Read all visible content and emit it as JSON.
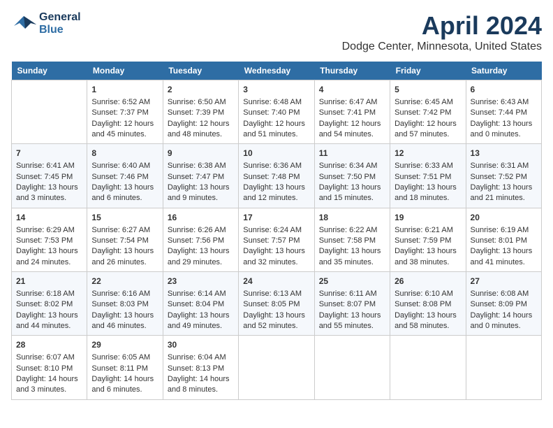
{
  "header": {
    "logo_line1": "General",
    "logo_line2": "Blue",
    "month": "April 2024",
    "location": "Dodge Center, Minnesota, United States"
  },
  "days_of_week": [
    "Sunday",
    "Monday",
    "Tuesday",
    "Wednesday",
    "Thursday",
    "Friday",
    "Saturday"
  ],
  "weeks": [
    [
      {
        "num": "",
        "data": ""
      },
      {
        "num": "1",
        "data": "Sunrise: 6:52 AM\nSunset: 7:37 PM\nDaylight: 12 hours\nand 45 minutes."
      },
      {
        "num": "2",
        "data": "Sunrise: 6:50 AM\nSunset: 7:39 PM\nDaylight: 12 hours\nand 48 minutes."
      },
      {
        "num": "3",
        "data": "Sunrise: 6:48 AM\nSunset: 7:40 PM\nDaylight: 12 hours\nand 51 minutes."
      },
      {
        "num": "4",
        "data": "Sunrise: 6:47 AM\nSunset: 7:41 PM\nDaylight: 12 hours\nand 54 minutes."
      },
      {
        "num": "5",
        "data": "Sunrise: 6:45 AM\nSunset: 7:42 PM\nDaylight: 12 hours\nand 57 minutes."
      },
      {
        "num": "6",
        "data": "Sunrise: 6:43 AM\nSunset: 7:44 PM\nDaylight: 13 hours\nand 0 minutes."
      }
    ],
    [
      {
        "num": "7",
        "data": "Sunrise: 6:41 AM\nSunset: 7:45 PM\nDaylight: 13 hours\nand 3 minutes."
      },
      {
        "num": "8",
        "data": "Sunrise: 6:40 AM\nSunset: 7:46 PM\nDaylight: 13 hours\nand 6 minutes."
      },
      {
        "num": "9",
        "data": "Sunrise: 6:38 AM\nSunset: 7:47 PM\nDaylight: 13 hours\nand 9 minutes."
      },
      {
        "num": "10",
        "data": "Sunrise: 6:36 AM\nSunset: 7:48 PM\nDaylight: 13 hours\nand 12 minutes."
      },
      {
        "num": "11",
        "data": "Sunrise: 6:34 AM\nSunset: 7:50 PM\nDaylight: 13 hours\nand 15 minutes."
      },
      {
        "num": "12",
        "data": "Sunrise: 6:33 AM\nSunset: 7:51 PM\nDaylight: 13 hours\nand 18 minutes."
      },
      {
        "num": "13",
        "data": "Sunrise: 6:31 AM\nSunset: 7:52 PM\nDaylight: 13 hours\nand 21 minutes."
      }
    ],
    [
      {
        "num": "14",
        "data": "Sunrise: 6:29 AM\nSunset: 7:53 PM\nDaylight: 13 hours\nand 24 minutes."
      },
      {
        "num": "15",
        "data": "Sunrise: 6:27 AM\nSunset: 7:54 PM\nDaylight: 13 hours\nand 26 minutes."
      },
      {
        "num": "16",
        "data": "Sunrise: 6:26 AM\nSunset: 7:56 PM\nDaylight: 13 hours\nand 29 minutes."
      },
      {
        "num": "17",
        "data": "Sunrise: 6:24 AM\nSunset: 7:57 PM\nDaylight: 13 hours\nand 32 minutes."
      },
      {
        "num": "18",
        "data": "Sunrise: 6:22 AM\nSunset: 7:58 PM\nDaylight: 13 hours\nand 35 minutes."
      },
      {
        "num": "19",
        "data": "Sunrise: 6:21 AM\nSunset: 7:59 PM\nDaylight: 13 hours\nand 38 minutes."
      },
      {
        "num": "20",
        "data": "Sunrise: 6:19 AM\nSunset: 8:01 PM\nDaylight: 13 hours\nand 41 minutes."
      }
    ],
    [
      {
        "num": "21",
        "data": "Sunrise: 6:18 AM\nSunset: 8:02 PM\nDaylight: 13 hours\nand 44 minutes."
      },
      {
        "num": "22",
        "data": "Sunrise: 6:16 AM\nSunset: 8:03 PM\nDaylight: 13 hours\nand 46 minutes."
      },
      {
        "num": "23",
        "data": "Sunrise: 6:14 AM\nSunset: 8:04 PM\nDaylight: 13 hours\nand 49 minutes."
      },
      {
        "num": "24",
        "data": "Sunrise: 6:13 AM\nSunset: 8:05 PM\nDaylight: 13 hours\nand 52 minutes."
      },
      {
        "num": "25",
        "data": "Sunrise: 6:11 AM\nSunset: 8:07 PM\nDaylight: 13 hours\nand 55 minutes."
      },
      {
        "num": "26",
        "data": "Sunrise: 6:10 AM\nSunset: 8:08 PM\nDaylight: 13 hours\nand 58 minutes."
      },
      {
        "num": "27",
        "data": "Sunrise: 6:08 AM\nSunset: 8:09 PM\nDaylight: 14 hours\nand 0 minutes."
      }
    ],
    [
      {
        "num": "28",
        "data": "Sunrise: 6:07 AM\nSunset: 8:10 PM\nDaylight: 14 hours\nand 3 minutes."
      },
      {
        "num": "29",
        "data": "Sunrise: 6:05 AM\nSunset: 8:11 PM\nDaylight: 14 hours\nand 6 minutes."
      },
      {
        "num": "30",
        "data": "Sunrise: 6:04 AM\nSunset: 8:13 PM\nDaylight: 14 hours\nand 8 minutes."
      },
      {
        "num": "",
        "data": ""
      },
      {
        "num": "",
        "data": ""
      },
      {
        "num": "",
        "data": ""
      },
      {
        "num": "",
        "data": ""
      }
    ]
  ]
}
